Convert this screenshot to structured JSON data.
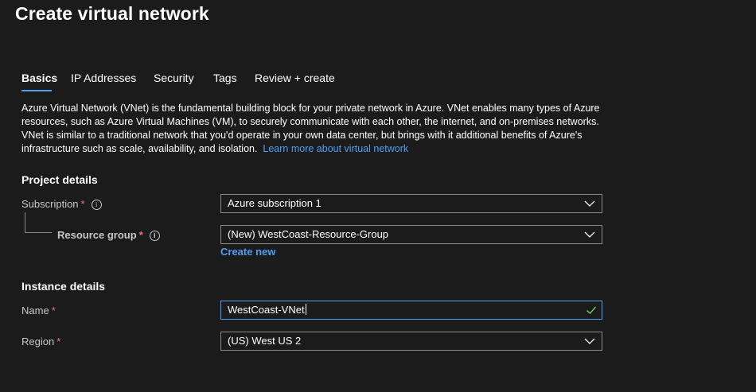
{
  "page": {
    "title": "Create virtual network"
  },
  "tabs": [
    {
      "label": "Basics",
      "active": true
    },
    {
      "label": "IP Addresses",
      "active": false
    },
    {
      "label": "Security",
      "active": false
    },
    {
      "label": "Tags",
      "active": false
    },
    {
      "label": "Review + create",
      "active": false
    }
  ],
  "intro": {
    "text": "Azure Virtual Network (VNet) is the fundamental building block for your private network in Azure. VNet enables many types of Azure resources, such as Azure Virtual Machines (VM), to securely communicate with each other, the internet, and on-premises networks. VNet is similar to a traditional network that you'd operate in your own data center, but brings with it additional benefits of Azure's infrastructure such as scale, availability, and isolation.",
    "link": "Learn more about virtual network"
  },
  "project": {
    "heading": "Project details",
    "subscription": {
      "label": "Subscription",
      "value": "Azure subscription 1"
    },
    "resource_group": {
      "label": "Resource group",
      "value": "(New) WestCoast-Resource-Group",
      "create_new": "Create new"
    }
  },
  "instance": {
    "heading": "Instance details",
    "name": {
      "label": "Name",
      "value": "WestCoast-VNet"
    },
    "region": {
      "label": "Region",
      "value": "(US) West US 2"
    }
  },
  "common": {
    "required": "*",
    "info_icon": "i"
  },
  "colors": {
    "accent": "#4f9ff5",
    "required": "#f1707b",
    "valid": "#6ccb5f",
    "background": "#1b1b1b"
  }
}
